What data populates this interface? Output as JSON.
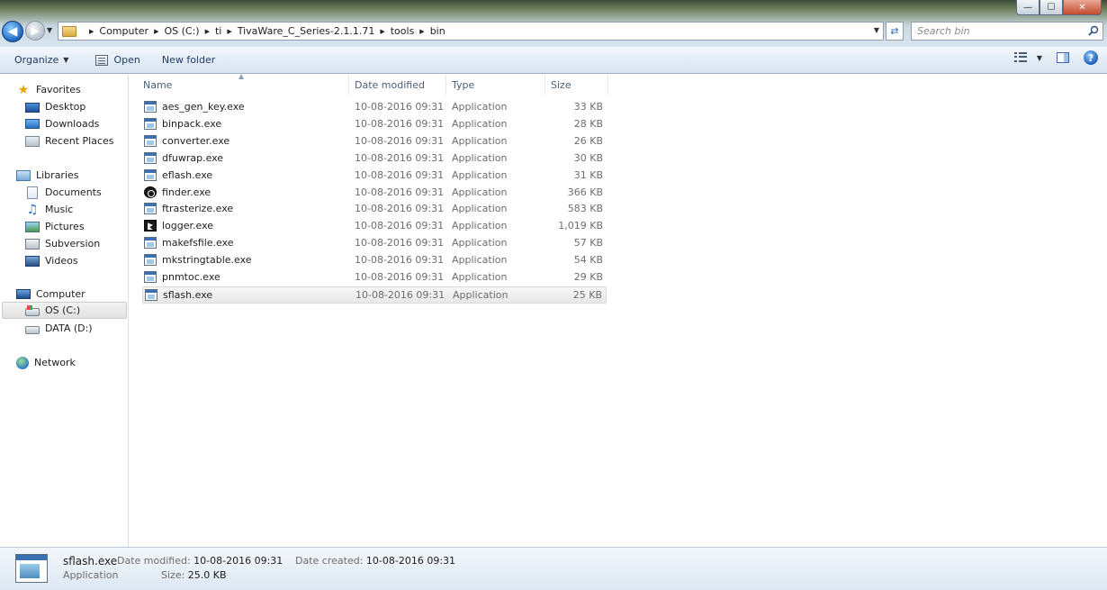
{
  "window": {
    "minimize_glyph": "—",
    "maximize_glyph": "☐",
    "close_glyph": "✕"
  },
  "address_bar": {
    "crumbs": [
      "Computer",
      "OS (C:)",
      "ti",
      "TivaWare_C_Series-2.1.1.71",
      "tools",
      "bin"
    ]
  },
  "search": {
    "placeholder": "Search bin"
  },
  "toolbar": {
    "organize_label": "Organize",
    "open_label": "Open",
    "new_folder_label": "New folder"
  },
  "sidebar": {
    "favorites": {
      "label": "Favorites",
      "items": [
        "Desktop",
        "Downloads",
        "Recent Places"
      ]
    },
    "libraries": {
      "label": "Libraries",
      "items": [
        "Documents",
        "Music",
        "Pictures",
        "Subversion",
        "Videos"
      ]
    },
    "computer": {
      "label": "Computer",
      "items": [
        "OS (C:)",
        "DATA (D:)"
      ]
    },
    "network": {
      "label": "Network"
    }
  },
  "columns": {
    "name": "Name",
    "date_modified": "Date modified",
    "type": "Type",
    "size": "Size"
  },
  "files": [
    {
      "name": "aes_gen_key.exe",
      "date": "10-08-2016 09:31",
      "type": "Application",
      "size": "33 KB",
      "icon": "app-icon"
    },
    {
      "name": "binpack.exe",
      "date": "10-08-2016 09:31",
      "type": "Application",
      "size": "28 KB",
      "icon": "app-icon"
    },
    {
      "name": "converter.exe",
      "date": "10-08-2016 09:31",
      "type": "Application",
      "size": "26 KB",
      "icon": "app-icon"
    },
    {
      "name": "dfuwrap.exe",
      "date": "10-08-2016 09:31",
      "type": "Application",
      "size": "30 KB",
      "icon": "app-icon"
    },
    {
      "name": "eflash.exe",
      "date": "10-08-2016 09:31",
      "type": "Application",
      "size": "31 KB",
      "icon": "app-icon"
    },
    {
      "name": "finder.exe",
      "date": "10-08-2016 09:31",
      "type": "Application",
      "size": "366 KB",
      "icon": "finder-icon"
    },
    {
      "name": "ftrasterize.exe",
      "date": "10-08-2016 09:31",
      "type": "Application",
      "size": "583 KB",
      "icon": "app-icon"
    },
    {
      "name": "logger.exe",
      "date": "10-08-2016 09:31",
      "type": "Application",
      "size": "1,019 KB",
      "icon": "logger-icon"
    },
    {
      "name": "makefsfile.exe",
      "date": "10-08-2016 09:31",
      "type": "Application",
      "size": "57 KB",
      "icon": "app-icon"
    },
    {
      "name": "mkstringtable.exe",
      "date": "10-08-2016 09:31",
      "type": "Application",
      "size": "54 KB",
      "icon": "app-icon"
    },
    {
      "name": "pnmtoc.exe",
      "date": "10-08-2016 09:31",
      "type": "Application",
      "size": "29 KB",
      "icon": "app-icon"
    },
    {
      "name": "sflash.exe",
      "date": "10-08-2016 09:31",
      "type": "Application",
      "size": "25 KB",
      "icon": "app-icon",
      "selected": true
    }
  ],
  "details": {
    "name": "sflash.exe",
    "type": "Application",
    "date_modified_label": "Date modified:",
    "date_modified": "10-08-2016 09:31",
    "size_label": "Size:",
    "size": "25.0 KB",
    "date_created_label": "Date created:",
    "date_created": "10-08-2016 09:31"
  }
}
